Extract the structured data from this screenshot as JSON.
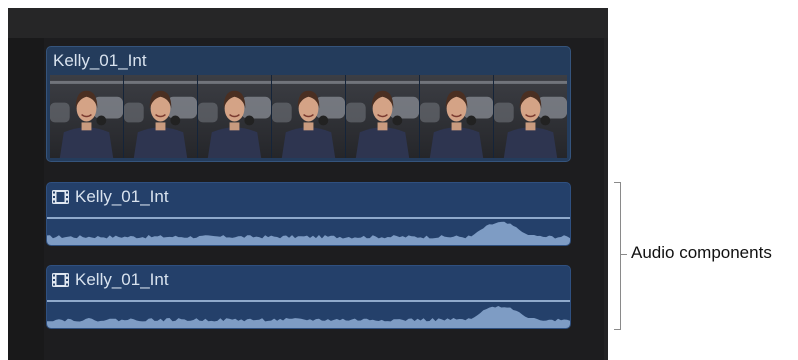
{
  "video_clip": {
    "title": "Kelly_01_Int",
    "frame_count": 7
  },
  "audio_clips": [
    {
      "title": "Kelly_01_Int",
      "icon": "film-icon"
    },
    {
      "title": "Kelly_01_Int",
      "icon": "film-icon"
    }
  ],
  "callout": {
    "label": "Audio components"
  },
  "colors": {
    "timeline_bg": "#1d1d1f",
    "video_clip": "#243c5c",
    "audio_clip": "#24406a",
    "waveform": "#7e9cc4",
    "callout_line": "#8a8a8a"
  }
}
